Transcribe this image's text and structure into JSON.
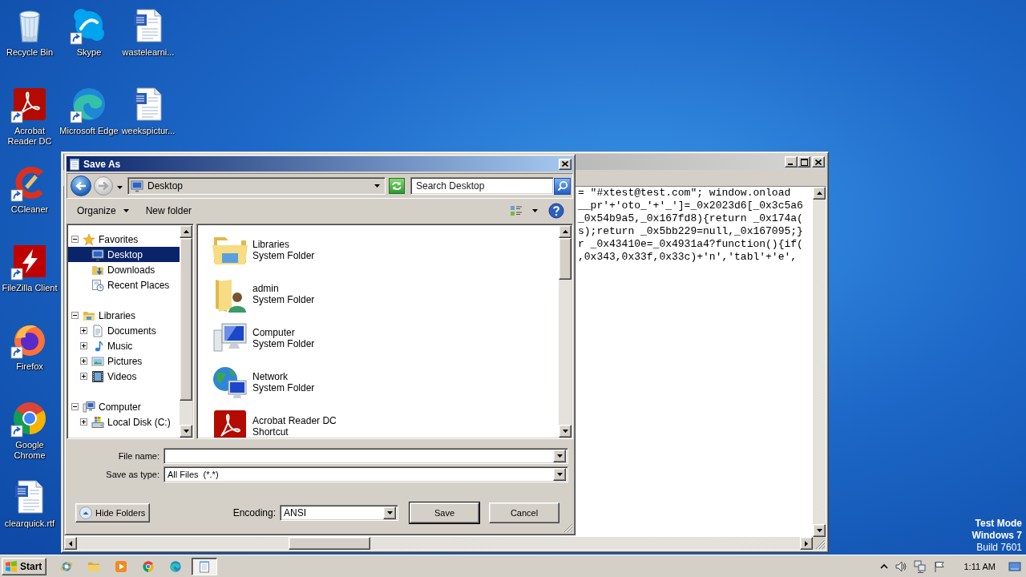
{
  "desktop": {
    "columns": [
      {
        "icons": [
          {
            "label": "Recycle Bin",
            "kind": "recycle-bin",
            "shortcut": false
          },
          {
            "label": "Acrobat Reader DC",
            "kind": "acrobat",
            "shortcut": true
          },
          {
            "label": "CCleaner",
            "kind": "ccleaner",
            "shortcut": true
          },
          {
            "label": "FileZilla Client",
            "kind": "filezilla",
            "shortcut": true
          },
          {
            "label": "Firefox",
            "kind": "firefox",
            "shortcut": true
          },
          {
            "label": "Google Chrome",
            "kind": "chrome",
            "shortcut": true
          },
          {
            "label": "clearquick.rtf",
            "kind": "word-document",
            "shortcut": false
          }
        ]
      },
      {
        "icons": [
          {
            "label": "Skype",
            "kind": "skype",
            "shortcut": true
          },
          {
            "label": "Microsoft Edge",
            "kind": "edge",
            "shortcut": true
          }
        ]
      },
      {
        "icons": [
          {
            "label": "wastelearni...",
            "kind": "word-document",
            "shortcut": false
          },
          {
            "label": "weekspictur...",
            "kind": "word-document",
            "shortcut": false
          }
        ]
      }
    ],
    "notice": [
      "Test Mode",
      "Windows 7",
      "Build 7601"
    ]
  },
  "notepad": {
    "lines": [
      "= \"#xtest@test.com\"; window.onload",
      "__pr'+'oto_'+'_']=_0x2023d6[_0x3c5a6",
      "_0x54b9a5,_0x167fd8){return _0x174a(",
      "s);return _0x5bb229=null,_0x167095;}",
      "r _0x43410e=_0x4931a4?function(){if(",
      ",0x343,0x33f,0x33c)+'n','tabl'+'e',"
    ]
  },
  "save_dialog": {
    "title": "Save As",
    "back": {
      "disabled": false
    },
    "forward": {
      "disabled": true
    },
    "address": "Desktop",
    "search": {
      "placeholder": "Search Desktop"
    },
    "toolbar": [
      {
        "label": "Organize",
        "kind": "menu"
      },
      {
        "label": "New folder",
        "kind": "button"
      }
    ],
    "nav_tree": [
      {
        "label": "Favorites",
        "kind": "favorites",
        "expanded": true,
        "selected": false,
        "children": [
          {
            "label": "Desktop",
            "kind": "desktop",
            "selected": true
          },
          {
            "label": "Downloads",
            "kind": "downloads",
            "selected": false
          },
          {
            "label": "Recent Places",
            "kind": "recent",
            "selected": false
          }
        ]
      },
      {
        "label": "Libraries",
        "kind": "libraries",
        "expanded": true,
        "selected": false,
        "children": [
          {
            "label": "Documents",
            "kind": "documents",
            "expanded": false,
            "selected": false
          },
          {
            "label": "Music",
            "kind": "music",
            "expanded": false,
            "selected": false
          },
          {
            "label": "Pictures",
            "kind": "pictures",
            "expanded": false,
            "selected": false
          },
          {
            "label": "Videos",
            "kind": "videos",
            "expanded": false,
            "selected": false
          }
        ]
      },
      {
        "label": "Computer",
        "kind": "computer",
        "expanded": true,
        "selected": false,
        "children": [
          {
            "label": "Local Disk (C:)",
            "kind": "drive",
            "expanded": false,
            "selected": false
          }
        ]
      }
    ],
    "files": [
      {
        "name": "Libraries",
        "type": "System Folder",
        "kind": "libraries",
        "selected": false
      },
      {
        "name": "admin",
        "type": "System Folder",
        "kind": "user-folder",
        "selected": false
      },
      {
        "name": "Computer",
        "type": "System Folder",
        "kind": "computer",
        "selected": false
      },
      {
        "name": "Network",
        "type": "System Folder",
        "kind": "network",
        "selected": false
      },
      {
        "name": "Acrobat Reader DC",
        "type": "Shortcut",
        "kind": "acrobat",
        "selected": false
      }
    ],
    "file_name": {
      "label": "File name:"
    },
    "save_as_type": {
      "label": "Save as type:",
      "value": "All Files  (*.*)"
    },
    "hide_folders": "Hide Folders",
    "encoding": {
      "label": "Encoding:",
      "value": "ANSI"
    },
    "buttons": [
      {
        "label": "Save",
        "default": true
      },
      {
        "label": "Cancel",
        "default": false
      }
    ]
  },
  "taskbar": {
    "start": "Start",
    "tasks": [
      {
        "selected": true
      }
    ],
    "clock": "1:11 AM"
  }
}
